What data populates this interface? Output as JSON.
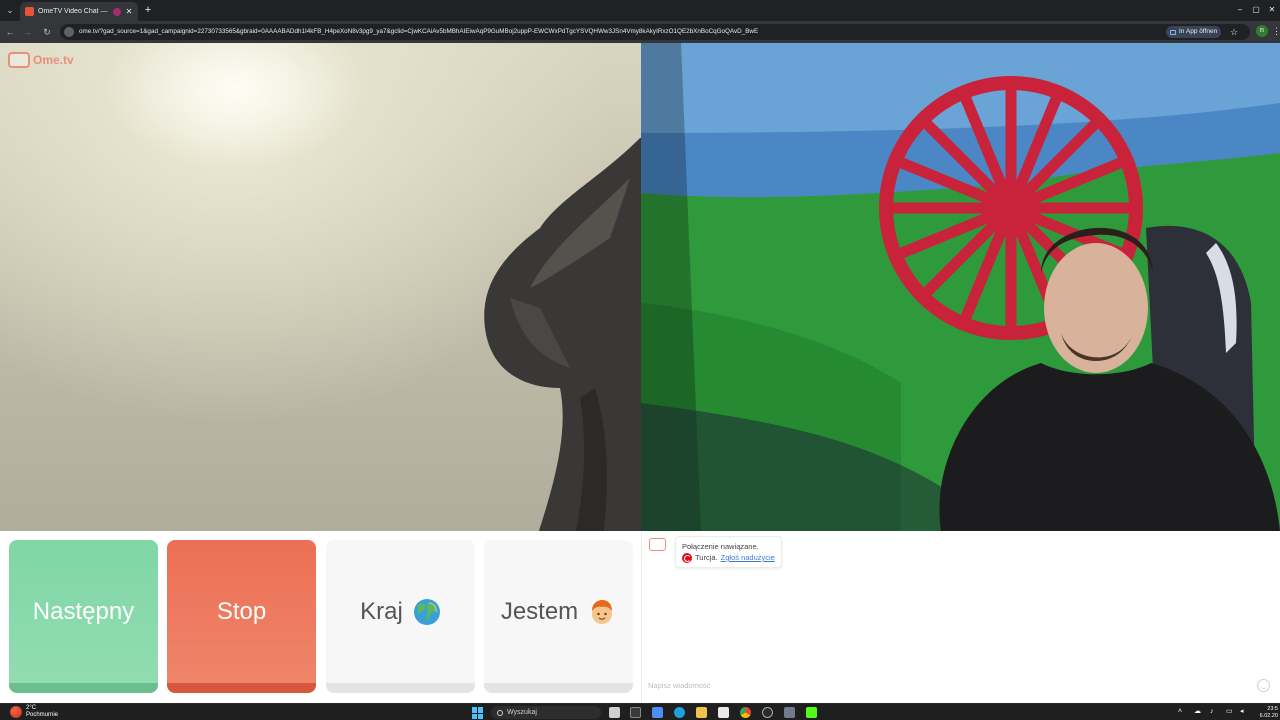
{
  "browser": {
    "tab_title": "OmeTV Video Chat — Ome",
    "tab_close": "✕",
    "new_tab": "+",
    "url": "ome.tv/?gad_source=1&gad_campaignid=22730733565&gbraid=0AAAABADdh1I4kFB_H4peXoN8v3pg9_ya7&gclid=CjwKCAiAv5bMBhAIEiwAqP9GuMBoj2uppP-EWCWxPdTgcYSVQHWw3JSn4Vmy8kAkyIRxzO1QE2bXnBoCqGoQAvD_BwE",
    "open_in_app": "In App öffnen",
    "profile_initial": "n",
    "window_minimize": "–",
    "window_maximize": "▢",
    "window_close": "✕"
  },
  "site": {
    "logo_text": "Ome.tv"
  },
  "controls": {
    "next_label": "Następny",
    "stop_label": "Stop",
    "country_label": "Kraj",
    "iam_label": "Jestem"
  },
  "chat": {
    "status_message": "Połączenie nawiązane.",
    "country": "Turcja.",
    "report_link": "Zgłoś nadużycie",
    "input_placeholder": "Napisz wiadomość"
  },
  "taskbar": {
    "weather_temp": "2°C",
    "weather_desc": "Pochmurnie",
    "search_label": "Wyszukaj",
    "clock_time": "23:5",
    "clock_date": "6.02.20"
  },
  "colors": {
    "next": "#7fd6a5",
    "stop": "#ec6f55",
    "neutral_button": "#f7f7f7",
    "brand": "#e8907d",
    "link": "#3a7bd5"
  }
}
